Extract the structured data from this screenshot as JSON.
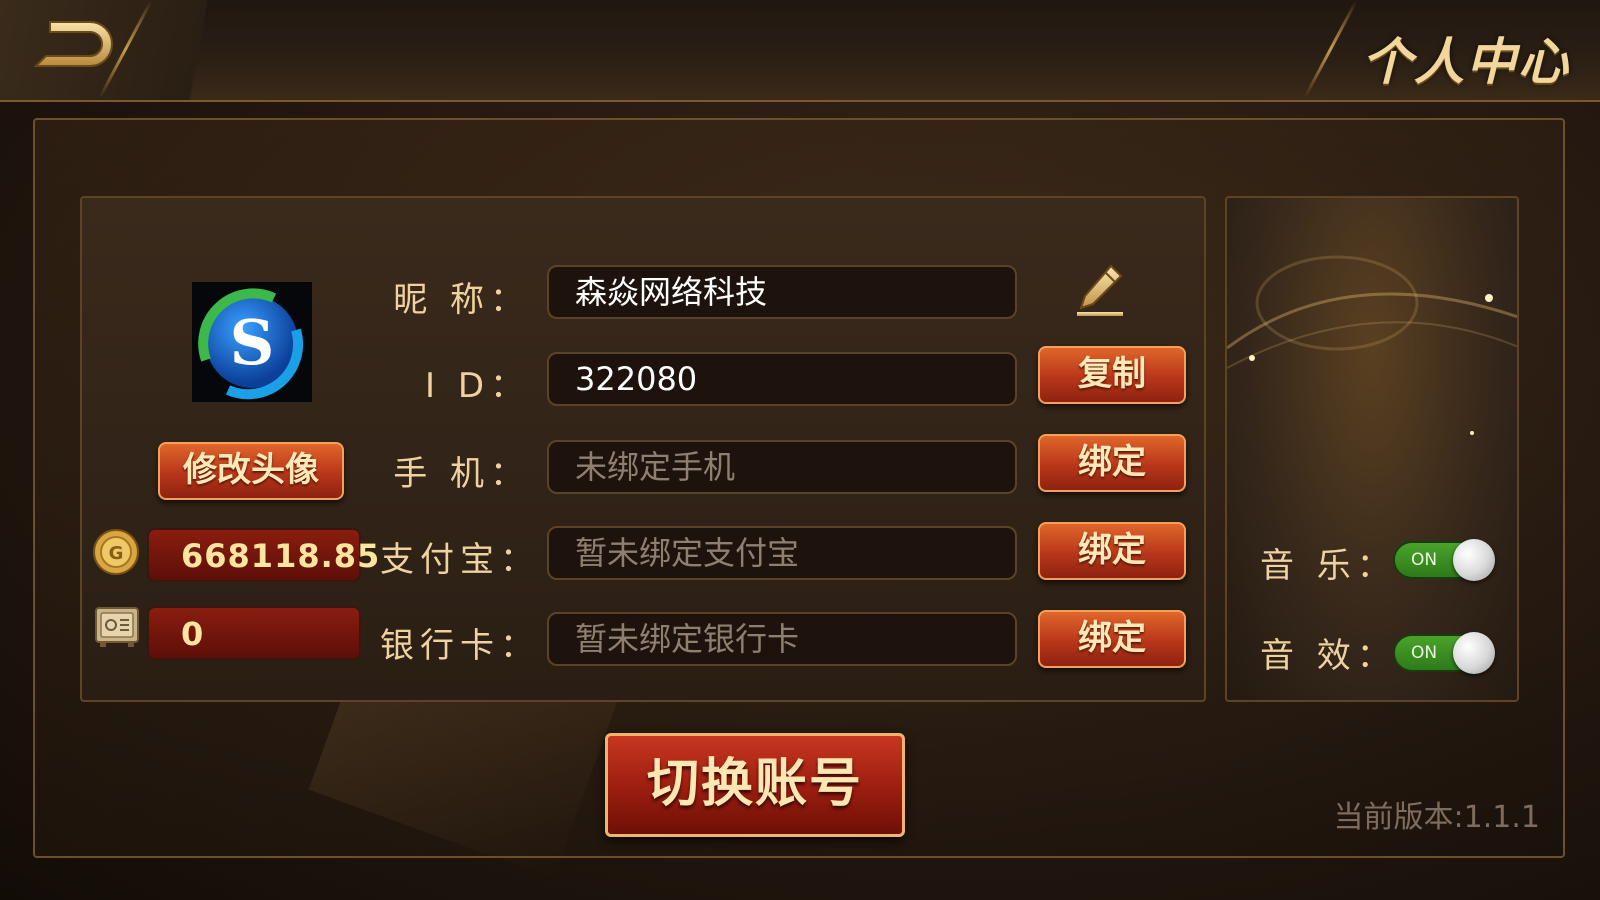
{
  "header": {
    "title": "个人中心",
    "back_icon": "back-arrow-icon"
  },
  "profile": {
    "change_avatar_label": "修改头像",
    "avatar_icon": "avatar-logo-s",
    "coins": "668118.85",
    "bank": "0",
    "coin_icon": "coin-icon",
    "safe_icon": "safe-icon"
  },
  "fields": {
    "nickname": {
      "label": "昵 称：",
      "value": "森焱网络科技"
    },
    "id": {
      "label": "I D：",
      "value": "322080",
      "action": "复制"
    },
    "phone": {
      "label": "手 机：",
      "placeholder": "未绑定手机",
      "action": "绑定"
    },
    "alipay": {
      "label": "支付宝：",
      "placeholder": "暂未绑定支付宝",
      "action": "绑定"
    },
    "bankcard": {
      "label": "银行卡：",
      "placeholder": "暂未绑定银行卡",
      "action": "绑定"
    }
  },
  "settings": {
    "music_label": "音 乐：",
    "music_state": "ON",
    "sound_label": "音 效：",
    "sound_state": "ON"
  },
  "switch_account_label": "切换账号",
  "version": "当前版本:1.1.1",
  "colors": {
    "gold_text": "#f0d2a0",
    "button_orange": "#c8431e",
    "toggle_green": "#4aa32c"
  }
}
